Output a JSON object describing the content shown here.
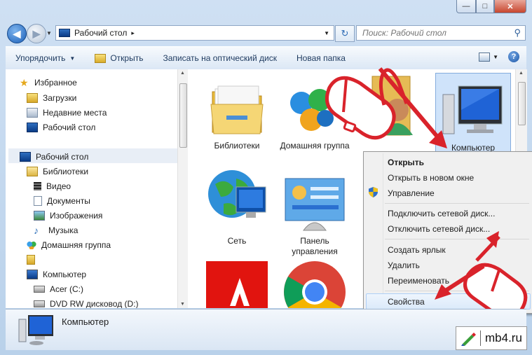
{
  "window": {
    "controls": {
      "minimize": "—",
      "maximize": "□",
      "close": "✕"
    }
  },
  "address": {
    "path": "Рабочий стол",
    "separator": "▸",
    "dropdown": "▾",
    "search_placeholder": "Поиск: Рабочий стол"
  },
  "toolbar": {
    "organize": "Упорядочить",
    "open": "Открыть",
    "burn": "Записать на оптический диск",
    "new_folder": "Новая папка",
    "help": "?"
  },
  "nav": {
    "items": [
      {
        "label": "Избранное",
        "icon": "star-icon"
      },
      {
        "label": "Загрузки",
        "icon": "downloads-folder-icon"
      },
      {
        "label": "Недавние места",
        "icon": "recent-places-icon"
      },
      {
        "label": "Рабочий стол",
        "icon": "desktop-icon"
      },
      {
        "label": "Рабочий стол",
        "icon": "desktop-icon"
      },
      {
        "label": "Библиотеки",
        "icon": "libraries-icon"
      },
      {
        "label": "Видео",
        "icon": "video-icon"
      },
      {
        "label": "Документы",
        "icon": "documents-icon"
      },
      {
        "label": "Изображения",
        "icon": "images-icon"
      },
      {
        "label": "Музыка",
        "icon": "music-icon"
      },
      {
        "label": "Домашняя группа",
        "icon": "homegroup-icon"
      },
      {
        "label": "",
        "icon": "user-folder-icon"
      },
      {
        "label": "Компьютер",
        "icon": "computer-icon"
      },
      {
        "label": "Acer (C:)",
        "icon": "drive-icon"
      },
      {
        "label": "DVD RW дисковод (D:)",
        "icon": "dvd-drive-icon"
      }
    ]
  },
  "main": {
    "items": [
      {
        "label": "Библиотеки"
      },
      {
        "label": "Домашняя группа"
      },
      {
        "label": "Компьютер"
      },
      {
        "label": "Сеть"
      },
      {
        "label": "Панель управления"
      }
    ]
  },
  "context_menu": {
    "items": [
      "Открыть",
      "Открыть в новом окне",
      "Управление",
      "Подключить сетевой диск...",
      "Отключить сетевой диск...",
      "Создать ярлык",
      "Удалить",
      "Переименовать",
      "Свойства"
    ]
  },
  "status": {
    "label": "Компьютер"
  },
  "watermark": {
    "text": "mb4.ru"
  },
  "colors": {
    "accent": "#d9232b",
    "selection": "#cfe3fa"
  }
}
